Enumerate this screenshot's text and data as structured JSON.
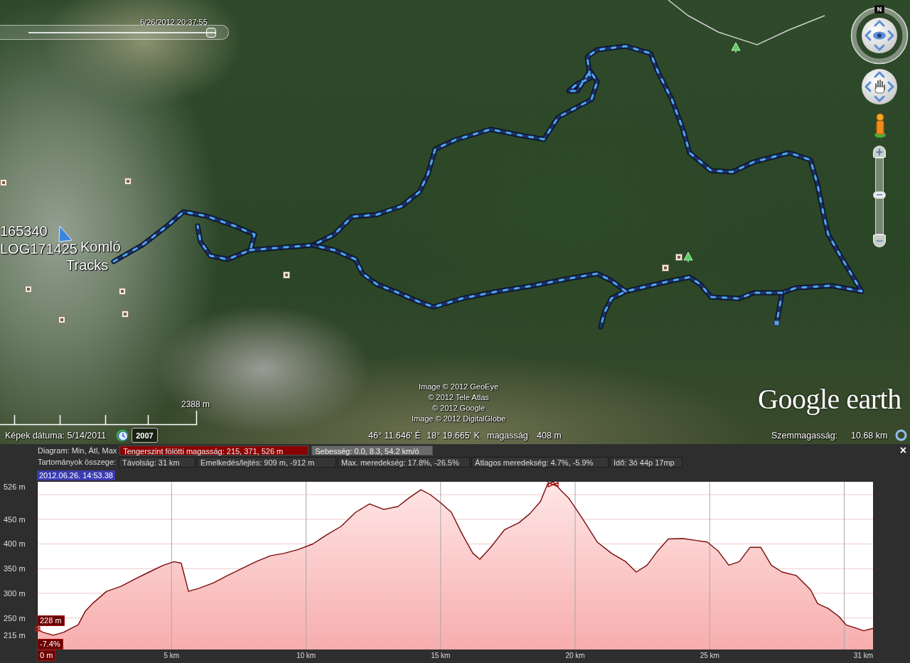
{
  "map": {
    "time_slider": {
      "timestamp": "6/26/2012 20:37:55",
      "level": 1
    },
    "labels": [
      "165340",
      "LOG171425",
      "Komló",
      "Tracks"
    ],
    "copyright": [
      "Image © 2012 GeoEye",
      "© 2012 Tele Atlas",
      "© 2012 Google",
      "Image © 2012 DigitalGlobe"
    ],
    "logo": "Google earth",
    "scale": "2388 m",
    "compass": {
      "north": "N"
    },
    "zoom_slider": {
      "level": 0.52
    },
    "status": {
      "imagery_date": "Képek dátuma: 5/14/2011",
      "historical_year": "2007",
      "latitude": "46° 11.646' É",
      "longitude": "18° 19.665' K",
      "elevation_label": "magasság",
      "elevation": "408 m",
      "eye_altitude_label": "Szemmagasság:",
      "eye_altitude": "10.68 km"
    }
  },
  "profile": {
    "close": "×",
    "diagram_label": "Diagram: Min, Átl, Max",
    "metrics": [
      {
        "text": "Tengerszint fölötti magasság: 215, 371, 526 m",
        "selected": true
      },
      {
        "text": "Sebesség: 0.0, 8.3, 54.2 km/ó",
        "selected": false
      }
    ],
    "totals_label": "Tartományok összege:",
    "totals": [
      "Távolság: 31 km",
      "Emelkedés/lejtés: 909 m, -912 m",
      "Max. meredekség: 17.8%, -26.5%",
      "Átlagos meredekség: 4.7%, -5.9%",
      "Idő: 3ó 44p 17mp"
    ],
    "timestamp": "2012.06.26. 14:53.38",
    "cursor": {
      "elevation": "228 m",
      "slope": "-7.4%",
      "distance": "0 m"
    },
    "chart_data": {
      "type": "area",
      "grid": true,
      "x": [
        0,
        0.21,
        0.61,
        1.0,
        1.27,
        1.53,
        1.8,
        2.06,
        2.59,
        3.12,
        3.65,
        4.17,
        4.7,
        5.1,
        5.36,
        5.63,
        6.02,
        6.55,
        7.08,
        7.61,
        8.14,
        8.67,
        9.19,
        9.72,
        10.25,
        10.78,
        11.31,
        11.84,
        12.36,
        12.89,
        13.42,
        13.82,
        14.27,
        14.61,
        15.01,
        15.4,
        15.79,
        16.2,
        16.46,
        16.86,
        17.38,
        17.91,
        18.31,
        18.71,
        18.97,
        19.18,
        19.5,
        19.76,
        20.29,
        20.82,
        21.35,
        21.88,
        22.27,
        22.67,
        23.07,
        23.46,
        23.99,
        24.52,
        24.91,
        25.31,
        25.71,
        26.1,
        26.5,
        26.9,
        27.29,
        27.69,
        28.22,
        28.75,
        29.01,
        29.41,
        29.8,
        30.07,
        30.46,
        30.72,
        31.07
      ],
      "values": [
        228,
        221,
        215,
        221,
        229,
        236,
        264,
        279,
        304,
        314,
        329,
        343,
        357,
        364,
        361,
        304,
        310,
        321,
        336,
        350,
        364,
        376,
        381,
        389,
        400,
        419,
        436,
        464,
        481,
        470,
        476,
        493,
        510,
        500,
        483,
        464,
        421,
        381,
        369,
        393,
        429,
        443,
        461,
        486,
        521,
        526,
        507,
        493,
        450,
        404,
        381,
        364,
        343,
        357,
        386,
        410,
        411,
        407,
        404,
        386,
        357,
        364,
        393,
        393,
        357,
        343,
        336,
        307,
        279,
        269,
        253,
        236,
        229,
        224,
        229
      ],
      "xlim": [
        0,
        31.07
      ],
      "ylim": [
        186,
        526
      ],
      "xticks": [
        {
          "value": 5,
          "label": "5 km"
        },
        {
          "value": 10,
          "label": "10 km"
        },
        {
          "value": 15,
          "label": "15 km"
        },
        {
          "value": 20,
          "label": "20 km"
        },
        {
          "value": 25,
          "label": "25 km"
        },
        {
          "value": 31.07,
          "label": "31 km"
        }
      ],
      "yticks": [
        {
          "value": 526,
          "label": "526 m"
        },
        {
          "value": 450,
          "label": "450 m"
        },
        {
          "value": 400,
          "label": "400 m"
        },
        {
          "value": 350,
          "label": "350 m"
        },
        {
          "value": 300,
          "label": "300 m"
        },
        {
          "value": 250,
          "label": "250 m"
        },
        {
          "value": 215,
          "label": "215 m"
        }
      ]
    }
  }
}
